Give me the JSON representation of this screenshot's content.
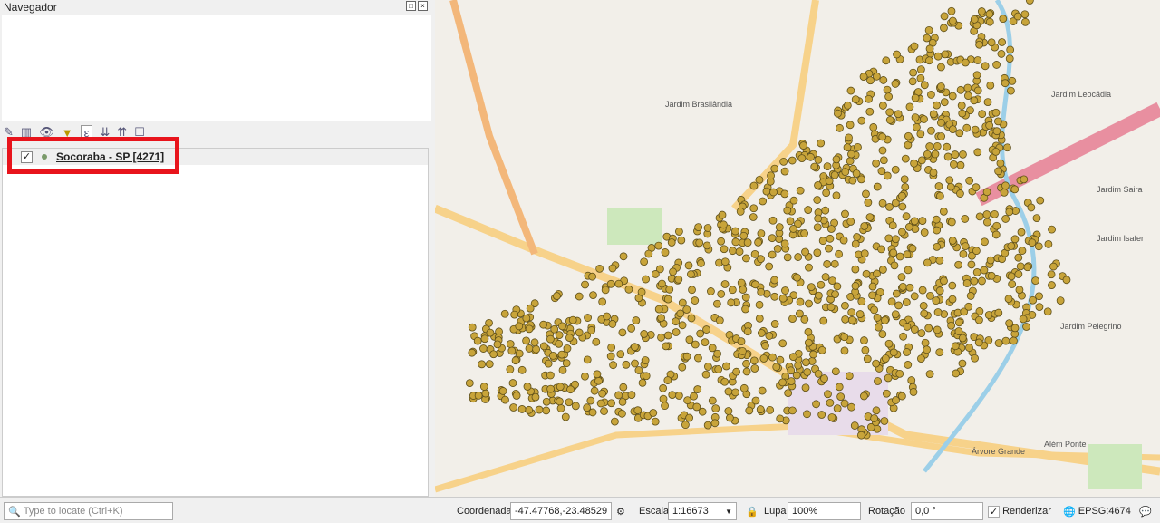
{
  "navigator": {
    "title": "Navegador"
  },
  "layers": {
    "items": [
      {
        "name": "Socoraba - SP [4271]",
        "checked": true
      }
    ]
  },
  "map": {
    "labels": [
      "Jardim Brasilândia",
      "Jardim Leocádia",
      "Jardim Saira",
      "Jardim Isafer",
      "Jardim Pelegrino",
      "Árvore Grande",
      "Além Ponte"
    ],
    "point_color": "#c8a43a"
  },
  "status": {
    "locate_placeholder": "Type to locate (Ctrl+K)",
    "coord_label": "Coordenada",
    "coord_value": "-47.47768,-23.48529",
    "scale_label": "Escala",
    "scale_value": "1:16673",
    "magnifier_label": "Lupa",
    "magnifier_value": "100%",
    "rotation_label": "Rotação",
    "rotation_value": "0,0 °",
    "render_label": "Renderizar",
    "crs": "EPSG:4674"
  }
}
